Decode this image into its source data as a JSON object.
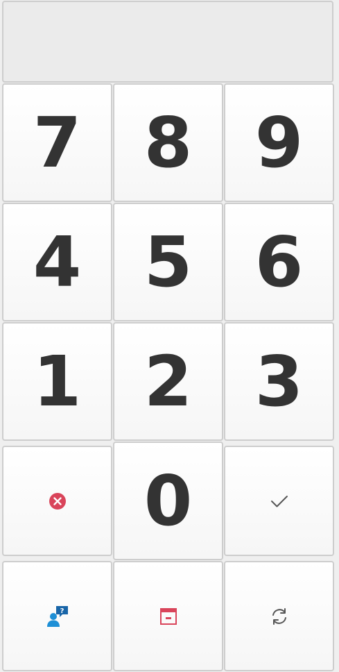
{
  "keypad": {
    "digits": {
      "k7": "7",
      "k8": "8",
      "k9": "9",
      "k4": "4",
      "k5": "5",
      "k6": "6",
      "k1": "1",
      "k2": "2",
      "k3": "3",
      "k0": "0"
    },
    "icons": {
      "clear": "close-circle-icon",
      "confirm": "checkmark-icon",
      "help": "user-question-icon",
      "calendar": "calendar-remove-icon",
      "refresh": "refresh-icon"
    },
    "colors": {
      "clear_red": "#d9445a",
      "help_blue": "#1e8fd6",
      "help_bubble": "#1865a8",
      "calendar_red": "#d9445a",
      "digit_text": "#333333"
    }
  }
}
